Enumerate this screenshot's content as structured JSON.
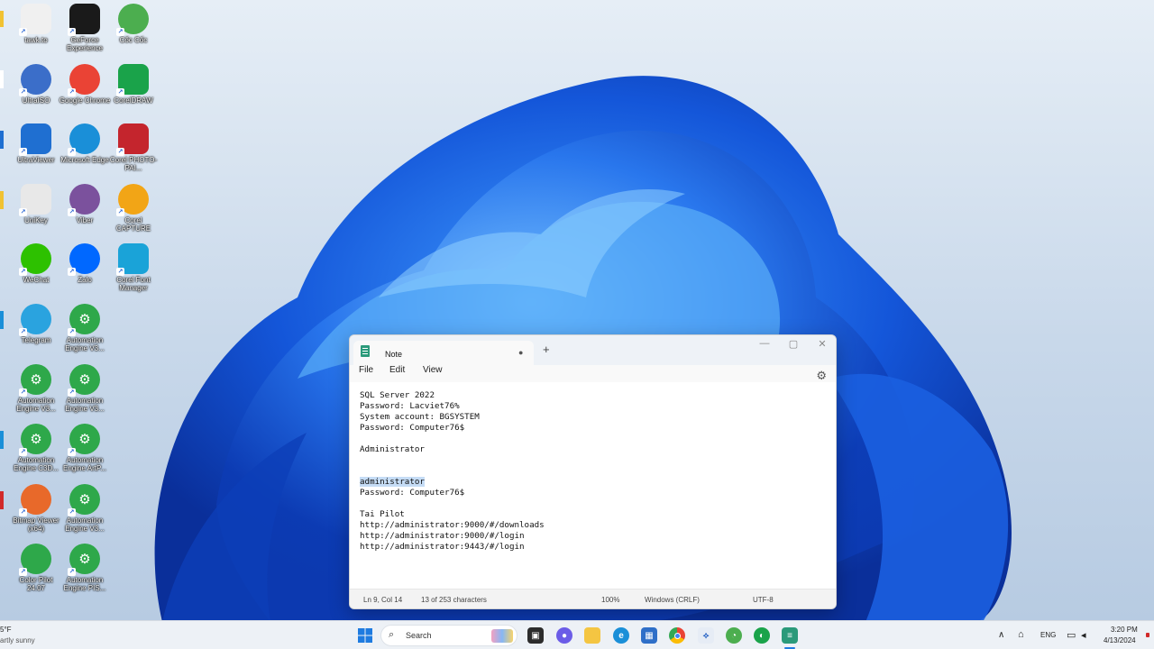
{
  "desktop": {
    "icons": [
      {
        "label": "tawk.to",
        "icon": "tawkto-icon",
        "color": "#f0f0f0"
      },
      {
        "label": "GeForce Experience",
        "icon": "geforce-icon",
        "color": "#1a1a1a"
      },
      {
        "label": "Cốc Cốc",
        "icon": "coccoc-icon",
        "color": "#4cae4f"
      },
      {
        "label": "UltraISO",
        "icon": "ultraiso-icon",
        "color": "#3b6ec9"
      },
      {
        "label": "Google Chrome",
        "icon": "chrome-icon",
        "color": "#ea4335"
      },
      {
        "label": "CorelDRAW",
        "icon": "coreldraw-icon",
        "color": "#1aa34a"
      },
      {
        "label": "UltraViewer",
        "icon": "ultraviewer-icon",
        "color": "#1f6fd1"
      },
      {
        "label": "Microsoft Edge",
        "icon": "edge-icon",
        "color": "#1a8fd8"
      },
      {
        "label": "Corel PHOTO-PAI...",
        "icon": "corel-photopaint-icon",
        "color": "#c4252d"
      },
      {
        "label": "UniKey",
        "icon": "unikey-icon",
        "color": "#e8e8e8"
      },
      {
        "label": "Viber",
        "icon": "viber-icon",
        "color": "#7b519d"
      },
      {
        "label": "Corel CAPTURE",
        "icon": "corel-capture-icon",
        "color": "#f2a516"
      },
      {
        "label": "WeChat",
        "icon": "wechat-icon",
        "color": "#2dc100"
      },
      {
        "label": "Zalo",
        "icon": "zalo-icon",
        "color": "#0068ff"
      },
      {
        "label": "Corel Font Manager",
        "icon": "corel-font-manager-icon",
        "color": "#1aa3d8"
      },
      {
        "label": "Telegram",
        "icon": "telegram-icon",
        "color": "#2aa3df"
      },
      {
        "label": "Automation Engine V3...",
        "icon": "automation-engine-icon",
        "color": "#2ea84a"
      },
      {
        "label": "Automation Engine V3...",
        "icon": "automation-engine-icon",
        "color": "#2ea84a"
      },
      {
        "label": "Automation Engine V3...",
        "icon": "automation-engine-icon",
        "color": "#2ea84a"
      },
      {
        "label": "Automation Engine C3D...",
        "icon": "automation-engine-icon",
        "color": "#2ea84a"
      },
      {
        "label": "Automation Engine ArtP...",
        "icon": "automation-engine-icon",
        "color": "#2ea84a"
      },
      {
        "label": "Bitmap Viewer (x64)",
        "icon": "bitmap-viewer-icon",
        "color": "#e8692a"
      },
      {
        "label": "Automation Engine V3...",
        "icon": "automation-engine-icon",
        "color": "#2ea84a"
      },
      {
        "label": "Color Pilot 24.07",
        "icon": "color-pilot-icon",
        "color": "#2ea84a"
      },
      {
        "label": "Automation Engine PIS...",
        "icon": "automation-engine-icon",
        "color": "#2ea84a"
      }
    ]
  },
  "notepad": {
    "tab_title": "Note",
    "modified_dot": "●",
    "new_tab": "+",
    "controls": {
      "minimize": "—",
      "maximize": "▢",
      "close": "✕"
    },
    "menu": {
      "file": "File",
      "edit": "Edit",
      "view": "View"
    },
    "settings_icon": "⚙",
    "lines": [
      "SQL Server 2022",
      "Password: Lacviet76%",
      "System account: BGSYSTEM",
      "Password: Computer76$",
      "",
      "Administrator",
      "",
      "",
      "administrator",
      "Password: Computer76$",
      "",
      "Tai Pilot",
      "http://administrator:9000/#/downloads",
      "http://administrator:9000/#/login",
      "http://administrator:9443/#/login"
    ],
    "status": {
      "position": "Ln 9, Col 14",
      "selection": "13 of 253 characters",
      "zoom": "100%",
      "line_ending": "Windows (CRLF)",
      "encoding": "UTF-8"
    }
  },
  "taskbar": {
    "weather_temp": "5°F",
    "weather_text": "artly sunny",
    "search_placeholder": "Search",
    "language": "ENG",
    "time": "3:20 PM",
    "date": "4/13/2024"
  }
}
